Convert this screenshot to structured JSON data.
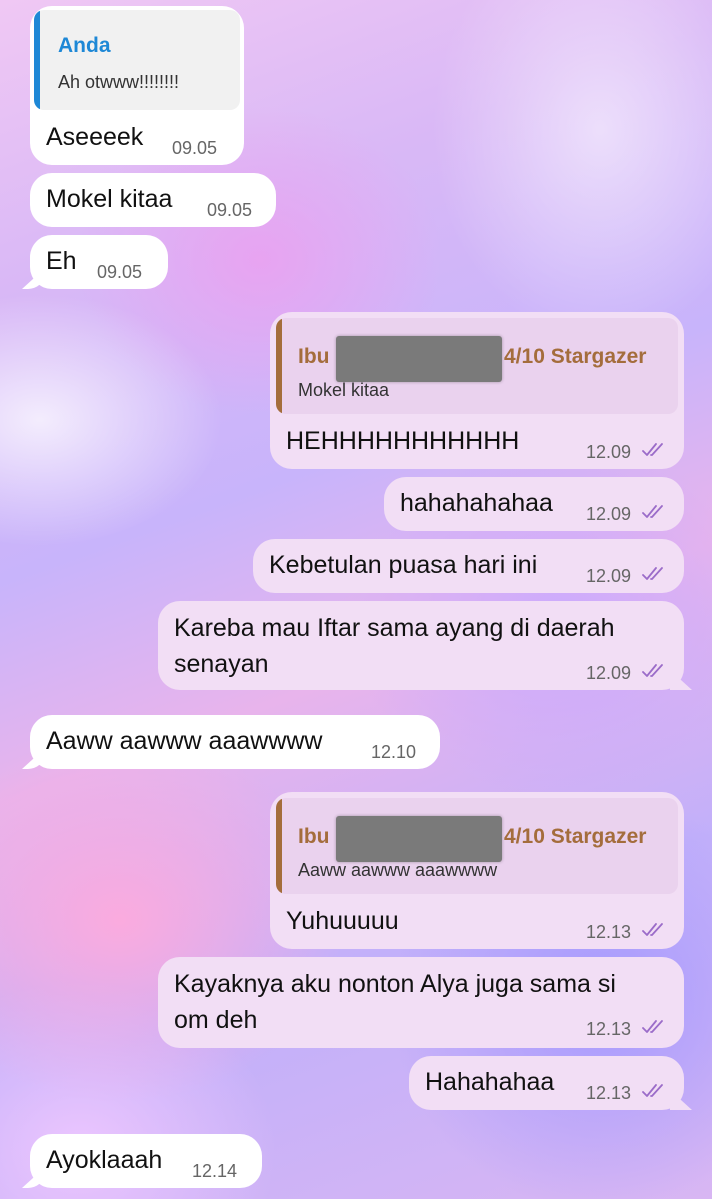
{
  "theme": {
    "incoming_bubble": "#ffffff",
    "outgoing_bubble": "#f2def5",
    "read_ticks": "#9b6cc9",
    "quote_in_accent": "#1e88d6",
    "quote_out_accent": "#a46d3c"
  },
  "messages": [
    {
      "side": "in",
      "text": "Aseeeek",
      "time": "09.05",
      "reply": {
        "name": "Anda",
        "text": "Ah otwww!!!!!!!!"
      }
    },
    {
      "side": "in",
      "text": "Mokel kitaa",
      "time": "09.05"
    },
    {
      "side": "in",
      "text": "Eh",
      "time": "09.05"
    },
    {
      "side": "out",
      "text": "HEHHHHHHHHHHH",
      "time": "12.09",
      "status": "read",
      "reply": {
        "name_prefix": "Ibu",
        "name_suffix": "4/10 Stargazer",
        "text": "Mokel kitaa",
        "redacted": true
      }
    },
    {
      "side": "out",
      "text": "hahahahahaa",
      "time": "12.09",
      "status": "read"
    },
    {
      "side": "out",
      "text": "Kebetulan puasa hari ini",
      "time": "12.09",
      "status": "read"
    },
    {
      "side": "out",
      "lines": [
        "Kareba mau Iftar sama ayang di daerah",
        "senayan"
      ],
      "time": "12.09",
      "status": "read"
    },
    {
      "side": "in",
      "text": "Aaww aawww aaawwww",
      "time": "12.10"
    },
    {
      "side": "out",
      "text": "Yuhuuuuu",
      "time": "12.13",
      "status": "read",
      "reply": {
        "name_prefix": "Ibu",
        "name_suffix": "4/10 Stargazer",
        "text": "Aaww aawww aaawwww",
        "redacted": true
      }
    },
    {
      "side": "out",
      "lines": [
        "Kayaknya aku nonton Alya juga sama si",
        "om deh"
      ],
      "time": "12.13",
      "status": "read"
    },
    {
      "side": "out",
      "text": "Hahahahaa",
      "time": "12.13",
      "status": "read"
    },
    {
      "side": "in",
      "text": "Ayoklaaah",
      "time": "12.14"
    }
  ]
}
